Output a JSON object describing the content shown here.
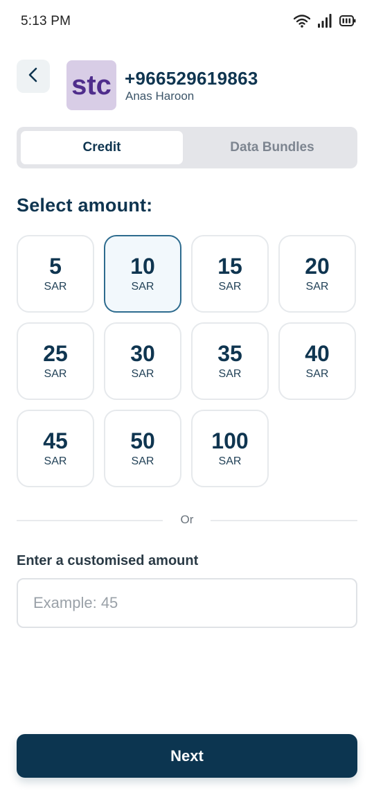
{
  "status_bar": {
    "time": "5:13 PM",
    "icons": [
      "wifi-icon",
      "signal-icon",
      "battery-icon"
    ]
  },
  "header": {
    "back_icon": "chevron-left-icon",
    "logo_text": "stc",
    "phone_number": "+966529619863",
    "contact_name": "Anas Haroon"
  },
  "tabs": [
    {
      "label": "Credit",
      "active": true
    },
    {
      "label": "Data Bundles",
      "active": false
    }
  ],
  "section_title": "Select amount:",
  "amounts": [
    {
      "value": "5",
      "currency": "SAR",
      "selected": false
    },
    {
      "value": "10",
      "currency": "SAR",
      "selected": true
    },
    {
      "value": "15",
      "currency": "SAR",
      "selected": false
    },
    {
      "value": "20",
      "currency": "SAR",
      "selected": false
    },
    {
      "value": "25",
      "currency": "SAR",
      "selected": false
    },
    {
      "value": "30",
      "currency": "SAR",
      "selected": false
    },
    {
      "value": "35",
      "currency": "SAR",
      "selected": false
    },
    {
      "value": "40",
      "currency": "SAR",
      "selected": false
    },
    {
      "value": "45",
      "currency": "SAR",
      "selected": false
    },
    {
      "value": "50",
      "currency": "SAR",
      "selected": false
    },
    {
      "value": "100",
      "currency": "SAR",
      "selected": false
    }
  ],
  "divider_text": "Or",
  "custom_amount": {
    "label": "Enter a customised amount",
    "value": "",
    "placeholder": "Example: 45"
  },
  "next_button": "Next",
  "colors": {
    "primary": "#0c3550",
    "selected_border": "#2d6b8e",
    "logo_bg": "#d8cde6",
    "logo_text": "#4f2d8c"
  }
}
